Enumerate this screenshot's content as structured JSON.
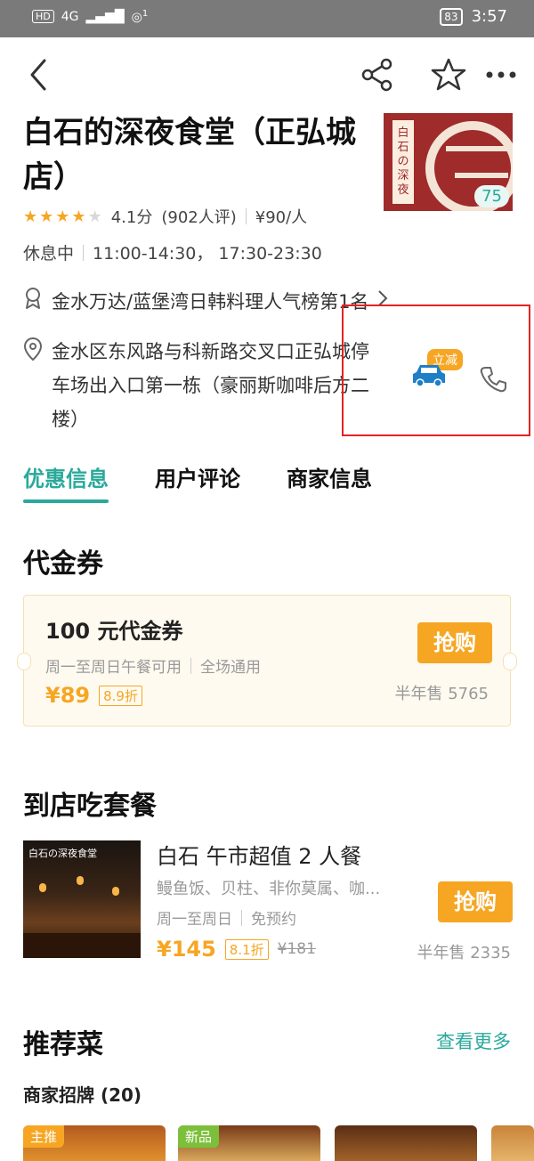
{
  "status_bar": {
    "hd": "HD",
    "network": "4G",
    "notif": "1",
    "battery": "83",
    "time": "3:57"
  },
  "restaurant": {
    "name": "白石的深夜食堂（正弘城店）",
    "logo_badge": "75",
    "rating_stars": 4,
    "score": "4.1分",
    "reviews": "(902人评)",
    "avg_price": "¥90/人",
    "status": "休息中",
    "hours": "11:00-14:30， 17:30-23:30",
    "rank": "金水万达/蓝堡湾日韩料理人气榜第1名",
    "address": "金水区东风路与科新路交叉口正弘城停车场出入口第一栋（豪丽斯咖啡后方二楼）",
    "car_tag": "立减"
  },
  "tabs": [
    "优惠信息",
    "用户评论",
    "商家信息"
  ],
  "voucher_section": {
    "title": "代金券",
    "voucher": {
      "name": "100 元代金券",
      "rule1": "周一至周日午餐可用",
      "rule2": "全场通用",
      "price": "¥89",
      "discount": "8.9折",
      "buy": "抢购",
      "sold": "半年售 5765"
    }
  },
  "meal_section": {
    "title": "到店吃套餐",
    "meal": {
      "name": "白石 午市超值 2 人餐",
      "desc": "鳗鱼饭、贝柱、非你莫属、咖...",
      "rule1": "周一至周日",
      "rule2": "免预约",
      "price": "¥145",
      "discount": "8.1折",
      "orig_price": "¥181",
      "buy": "抢购",
      "sold": "半年售 2335"
    }
  },
  "recommend_section": {
    "title": "推荐菜",
    "see_more": "查看更多",
    "subtitle": "商家招牌 (20)",
    "dishes": [
      {
        "tag": "主推",
        "tag_color": "#f6a623"
      },
      {
        "tag": "新品",
        "tag_color": "#7cbf3a"
      },
      {
        "tag": "",
        "tag_color": ""
      },
      {
        "tag": "",
        "tag_color": ""
      }
    ]
  },
  "icons": {
    "back": "back-arrow-icon",
    "share": "share-icon",
    "favorite": "star-outline-icon",
    "more": "more-dots-icon",
    "rank": "award-ribbon-icon",
    "location": "location-pin-icon",
    "car": "car-icon",
    "phone": "phone-icon"
  },
  "colors": {
    "accent": "#2aa99b",
    "orange": "#f6a623",
    "highlight_box": "#e32222"
  }
}
